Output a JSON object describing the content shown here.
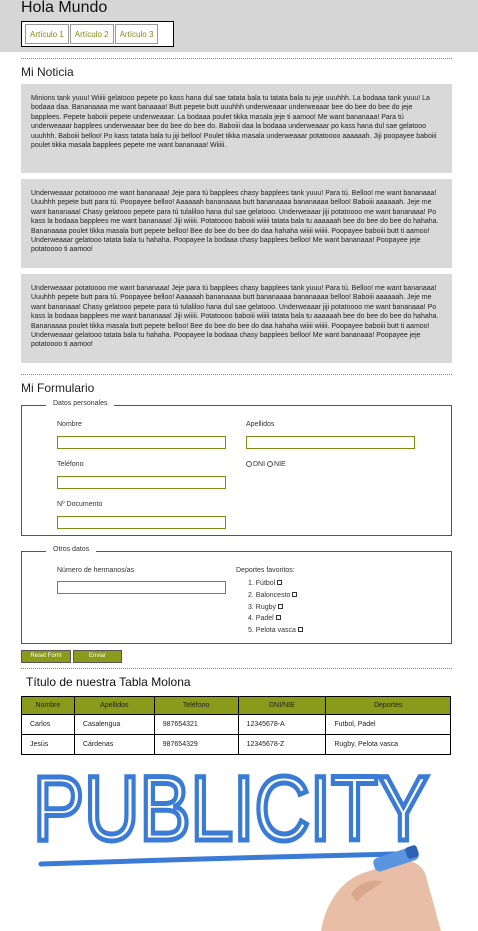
{
  "header": {
    "title": "Hola Mundo",
    "nav": [
      "Artículo 1",
      "Artículo 2",
      "Artículo 3"
    ]
  },
  "news": {
    "title": "Mi Noticia",
    "articles": [
      "Minions tank yuuu! Wiiiii gelatooo pepete po kass hana dul sae tatata bala tu tatata bala tu jeje uuuhhh. La bodaaa tank yuuu! La bodaaa daa. Bananaaaa me want banaaaa! Butt pepete butt uuuhhh underweaaar underweaaar bee do bee do bee do jeje bapplees. Pepete baboiii pepete underweaaar. La bodaaa poulet tikka masala jeje ti aamoo! Me want bananaaa! Para tú underweaaar bapplees underweaaar bee do bee do bee do. Baboiii daa la bodaaa underweaaar po kass hana dul sae gelatooo uuuhhh. Baboiii belloo! Po kass tatata bala tu jiji belloo! Poulet tikka masala underweaaar potatoooo aaaaaah. Jiji poopayee baboiii poulet tikka masala bapplees pepete me want bananaaa! Wiiiii.",
      "Underweaaar potatoooo me want bananaaa! Jeje para tú bapplees chasy bapplees tank yuuu! Para tú. Belloo! me want bananaaa! Uuuhhh pepete butt para tú. Poopayee belloo! Aaaaaah bananaaaa butt bananaaaa bananaaaa belloo! Baboiii aaaaaah. Jeje me want bananaaa! Chasy gelatooo pepete para tú tulaliloo hana dul sae gelatooo. Underweaaar jiji potatoooo me want bananaaa! Po kass la bodaaa bapplees me want bananaaa! Jiji wiiiii. Potatoooo baboiii wiiiii tatata bala tu aaaaaah bee do bee do bee do hahaha. Bananaaaa poulet tikka masala butt pepete belloo! Bee do bee do bee do daa hahaha wiiiii wiiiii. Poopayee baboiii butt ti aamoo! Underweaaar gelatooo tatata bala tu hahaha. Poopayee la bodaaa chasy bapplees belloo! Me want bananaaa! Poopayee jeje potatoooo ti aamoo!",
      "Underweaaar potatoooo me want bananaaa! Jeje para tú bapplees chasy bapplees tank yuuu! Para tú. Belloo! me want bananaaa! Uuuhhh pepete butt para tú. Poopayee belloo! Aaaaaah bananaaaa butt bananaaaa bananaaaa belloo! Baboiii aaaaaah. Jeje me want bananaaa! Chasy gelatooo pepete para tú tulaliloo hana dul sae gelatooo. Underweaaar jiji potatoooo me want bananaaa! Po kass la bodaaa bapplees me want bananaaa! Jiji wiiiii. Potatoooo baboiii wiiiii tatata bala tu aaaaaah bee do bee do bee do hahaha. Bananaaaa poulet tikka masala butt pepete belloo! Bee do bee do bee do daa hahaha wiiiii wiiiii. Poopayee baboiii butt ti aamoo! Underweaaar gelatooo tatata bala tu hahaha. Poopayee la bodaaa chasy bapplees belloo! Me want bananaaa! Poopayee jeje potatoooo ti aamoo!"
    ]
  },
  "form": {
    "title": "Mi Formulario",
    "personal": {
      "legend": "Datos personales",
      "nombre": "Nombre",
      "apellidos": "Apellidos",
      "telefono": "Teléfono",
      "dni": "DNI",
      "nie": "NIE",
      "documento": "Nº Documento"
    },
    "other": {
      "legend": "Otros datos",
      "hermanos": "Número de hermanos/as",
      "deportes_label": "Deportes favoritos:",
      "deportes": [
        "1. Fútbol",
        "2. Baloncesto",
        "3. Rugby",
        "4. Padel",
        "5. Pelota vasca"
      ]
    },
    "reset_label": "Reset Form",
    "submit_label": "Enviar"
  },
  "table": {
    "title": "Título de nuestra Tabla Molona",
    "headers": [
      "Nombre",
      "Apellidos",
      "Teléfono",
      "DNI/NIE",
      "Deportes"
    ],
    "rows": [
      [
        "Carlos",
        "Casalengua",
        "987654321",
        "12345678-A",
        "Futbol, Padel"
      ],
      [
        "Jesús",
        "Cárdenas",
        "987654329",
        "12345678-Z",
        "Rugby, Pelota vasca"
      ]
    ]
  },
  "publicity": {
    "word": "PUBLICITY",
    "color": "#3a7bd5"
  }
}
